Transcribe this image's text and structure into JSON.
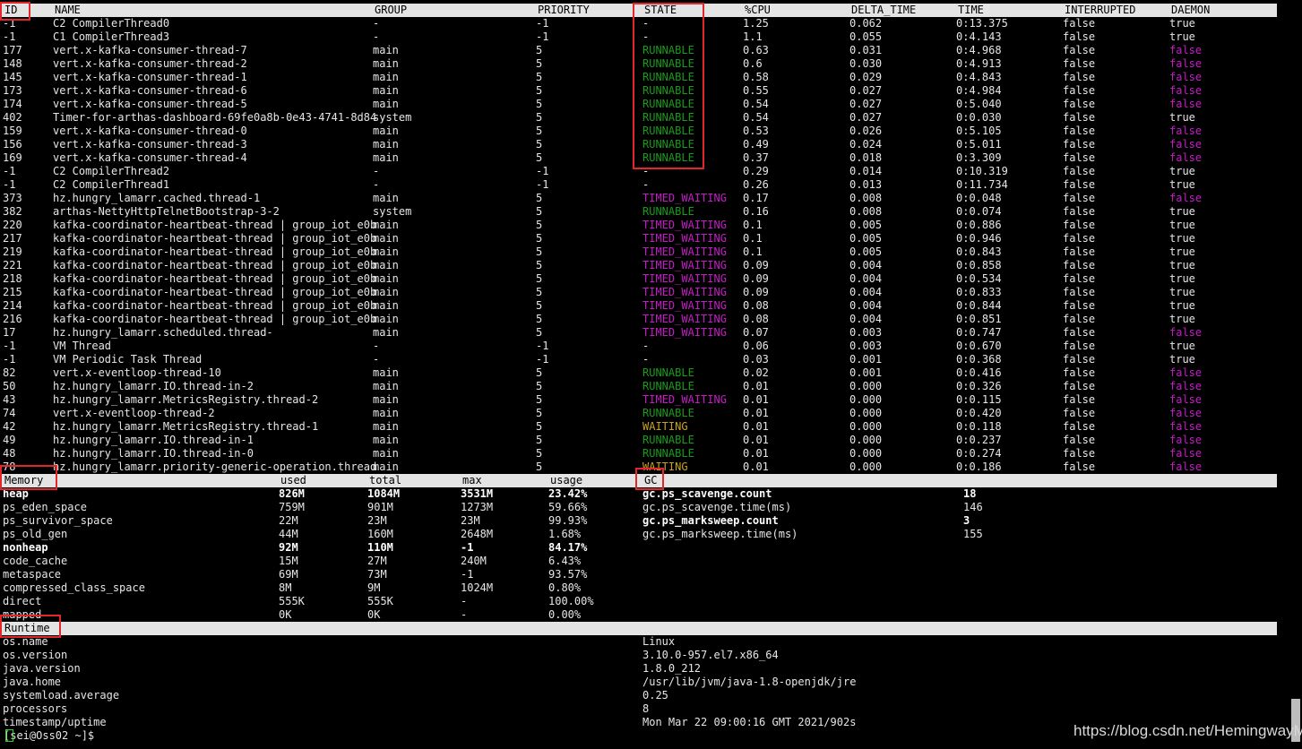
{
  "thread_table": {
    "headers": [
      "ID",
      "NAME",
      "GROUP",
      "PRIORITY",
      "STATE",
      "%CPU",
      "DELTA_TIME",
      "TIME",
      "INTERRUPTED",
      "DAEMON"
    ],
    "rows": [
      [
        "-1",
        "C2 CompilerThread0",
        "-",
        "-1",
        "-",
        "1.25",
        "0.062",
        "0:13.375",
        "false",
        "true"
      ],
      [
        "-1",
        "C1 CompilerThread3",
        "-",
        "-1",
        "-",
        "1.1",
        "0.055",
        "0:4.143",
        "false",
        "true"
      ],
      [
        "177",
        "vert.x-kafka-consumer-thread-7",
        "main",
        "5",
        "RUNNABLE",
        "0.63",
        "0.031",
        "0:4.968",
        "false",
        "false"
      ],
      [
        "148",
        "vert.x-kafka-consumer-thread-2",
        "main",
        "5",
        "RUNNABLE",
        "0.6",
        "0.030",
        "0:4.913",
        "false",
        "false"
      ],
      [
        "145",
        "vert.x-kafka-consumer-thread-1",
        "main",
        "5",
        "RUNNABLE",
        "0.58",
        "0.029",
        "0:4.843",
        "false",
        "false"
      ],
      [
        "173",
        "vert.x-kafka-consumer-thread-6",
        "main",
        "5",
        "RUNNABLE",
        "0.55",
        "0.027",
        "0:4.984",
        "false",
        "false"
      ],
      [
        "174",
        "vert.x-kafka-consumer-thread-5",
        "main",
        "5",
        "RUNNABLE",
        "0.54",
        "0.027",
        "0:5.040",
        "false",
        "false"
      ],
      [
        "402",
        "Timer-for-arthas-dashboard-69fe0a8b-0e43-4741-8d84",
        "system",
        "5",
        "RUNNABLE",
        "0.54",
        "0.027",
        "0:0.030",
        "false",
        "true"
      ],
      [
        "159",
        "vert.x-kafka-consumer-thread-0",
        "main",
        "5",
        "RUNNABLE",
        "0.53",
        "0.026",
        "0:5.105",
        "false",
        "false"
      ],
      [
        "156",
        "vert.x-kafka-consumer-thread-3",
        "main",
        "5",
        "RUNNABLE",
        "0.49",
        "0.024",
        "0:5.011",
        "false",
        "false"
      ],
      [
        "169",
        "vert.x-kafka-consumer-thread-4",
        "main",
        "5",
        "RUNNABLE",
        "0.37",
        "0.018",
        "0:3.309",
        "false",
        "false"
      ],
      [
        "-1",
        "C2 CompilerThread2",
        "-",
        "-1",
        "-",
        "0.29",
        "0.014",
        "0:10.319",
        "false",
        "true"
      ],
      [
        "-1",
        "C2 CompilerThread1",
        "-",
        "-1",
        "-",
        "0.26",
        "0.013",
        "0:11.734",
        "false",
        "true"
      ],
      [
        "373",
        "hz.hungry_lamarr.cached.thread-1",
        "main",
        "5",
        "TIMED_WAITING",
        "0.17",
        "0.008",
        "0:0.048",
        "false",
        "false"
      ],
      [
        "382",
        "arthas-NettyHttpTelnetBootstrap-3-2",
        "system",
        "5",
        "RUNNABLE",
        "0.16",
        "0.008",
        "0:0.074",
        "false",
        "true"
      ],
      [
        "220",
        "kafka-coordinator-heartbeat-thread | group_iot_e0b",
        "main",
        "5",
        "TIMED_WAITING",
        "0.1",
        "0.005",
        "0:0.886",
        "false",
        "true"
      ],
      [
        "217",
        "kafka-coordinator-heartbeat-thread | group_iot_e0b",
        "main",
        "5",
        "TIMED_WAITING",
        "0.1",
        "0.005",
        "0:0.946",
        "false",
        "true"
      ],
      [
        "219",
        "kafka-coordinator-heartbeat-thread | group_iot_e0b",
        "main",
        "5",
        "TIMED_WAITING",
        "0.1",
        "0.005",
        "0:0.843",
        "false",
        "true"
      ],
      [
        "221",
        "kafka-coordinator-heartbeat-thread | group_iot_e0b",
        "main",
        "5",
        "TIMED_WAITING",
        "0.09",
        "0.004",
        "0:0.858",
        "false",
        "true"
      ],
      [
        "218",
        "kafka-coordinator-heartbeat-thread | group_iot_e0b",
        "main",
        "5",
        "TIMED_WAITING",
        "0.09",
        "0.004",
        "0:0.534",
        "false",
        "true"
      ],
      [
        "215",
        "kafka-coordinator-heartbeat-thread | group_iot_e0b",
        "main",
        "5",
        "TIMED_WAITING",
        "0.09",
        "0.004",
        "0:0.833",
        "false",
        "true"
      ],
      [
        "214",
        "kafka-coordinator-heartbeat-thread | group_iot_e0b",
        "main",
        "5",
        "TIMED_WAITING",
        "0.08",
        "0.004",
        "0:0.844",
        "false",
        "true"
      ],
      [
        "216",
        "kafka-coordinator-heartbeat-thread | group_iot_e0b",
        "main",
        "5",
        "TIMED_WAITING",
        "0.08",
        "0.004",
        "0:0.851",
        "false",
        "true"
      ],
      [
        "17",
        "hz.hungry_lamarr.scheduled.thread-",
        "main",
        "5",
        "TIMED_WAITING",
        "0.07",
        "0.003",
        "0:0.747",
        "false",
        "false"
      ],
      [
        "-1",
        "VM Thread",
        "-",
        "-1",
        "-",
        "0.06",
        "0.003",
        "0:0.670",
        "false",
        "true"
      ],
      [
        "-1",
        "VM Periodic Task Thread",
        "-",
        "-1",
        "-",
        "0.03",
        "0.001",
        "0:0.368",
        "false",
        "true"
      ],
      [
        "82",
        "vert.x-eventloop-thread-10",
        "main",
        "5",
        "RUNNABLE",
        "0.02",
        "0.001",
        "0:0.416",
        "false",
        "false"
      ],
      [
        "50",
        "hz.hungry_lamarr.IO.thread-in-2",
        "main",
        "5",
        "RUNNABLE",
        "0.01",
        "0.000",
        "0:0.326",
        "false",
        "false"
      ],
      [
        "43",
        "hz.hungry_lamarr.MetricsRegistry.thread-2",
        "main",
        "5",
        "TIMED_WAITING",
        "0.01",
        "0.000",
        "0:0.115",
        "false",
        "false"
      ],
      [
        "74",
        "vert.x-eventloop-thread-2",
        "main",
        "5",
        "RUNNABLE",
        "0.01",
        "0.000",
        "0:0.420",
        "false",
        "false"
      ],
      [
        "42",
        "hz.hungry_lamarr.MetricsRegistry.thread-1",
        "main",
        "5",
        "WAITING",
        "0.01",
        "0.000",
        "0:0.118",
        "false",
        "false"
      ],
      [
        "49",
        "hz.hungry_lamarr.IO.thread-in-1",
        "main",
        "5",
        "RUNNABLE",
        "0.01",
        "0.000",
        "0:0.237",
        "false",
        "false"
      ],
      [
        "48",
        "hz.hungry_lamarr.IO.thread-in-0",
        "main",
        "5",
        "RUNNABLE",
        "0.01",
        "0.000",
        "0:0.274",
        "false",
        "false"
      ],
      [
        "78",
        "hz.hungry_lamarr.priority-generic-operation.thread",
        "main",
        "5",
        "WAITING",
        "0.01",
        "0.000",
        "0:0.186",
        "false",
        "false"
      ]
    ]
  },
  "memory": {
    "title": "Memory",
    "headers": [
      "used",
      "total",
      "max",
      "usage"
    ],
    "rows": [
      {
        "name": "heap",
        "used": "826M",
        "total": "1084M",
        "max": "3531M",
        "usage": "23.42%",
        "bold": true
      },
      {
        "name": "ps_eden_space",
        "used": "759M",
        "total": "901M",
        "max": "1273M",
        "usage": "59.66%",
        "bold": false
      },
      {
        "name": "ps_survivor_space",
        "used": "22M",
        "total": "23M",
        "max": "23M",
        "usage": "99.93%",
        "bold": false
      },
      {
        "name": "ps_old_gen",
        "used": "44M",
        "total": "160M",
        "max": "2648M",
        "usage": "1.68%",
        "bold": false
      },
      {
        "name": "nonheap",
        "used": "92M",
        "total": "110M",
        "max": "-1",
        "usage": "84.17%",
        "bold": true
      },
      {
        "name": "code_cache",
        "used": "15M",
        "total": "27M",
        "max": "240M",
        "usage": "6.43%",
        "bold": false
      },
      {
        "name": "metaspace",
        "used": "69M",
        "total": "73M",
        "max": "-1",
        "usage": "93.57%",
        "bold": false
      },
      {
        "name": "compressed_class_space",
        "used": "8M",
        "total": "9M",
        "max": "1024M",
        "usage": "0.80%",
        "bold": false
      },
      {
        "name": "direct",
        "used": "555K",
        "total": "555K",
        "max": "-",
        "usage": "100.00%",
        "bold": false
      },
      {
        "name": "mapped",
        "used": "0K",
        "total": "0K",
        "max": "-",
        "usage": "0.00%",
        "bold": false
      }
    ]
  },
  "gc": {
    "title": "GC",
    "rows": [
      {
        "name": "gc.ps_scavenge.count",
        "value": "18",
        "bold": true
      },
      {
        "name": "gc.ps_scavenge.time(ms)",
        "value": "146",
        "bold": false
      },
      {
        "name": "gc.ps_marksweep.count",
        "value": "3",
        "bold": true
      },
      {
        "name": "gc.ps_marksweep.time(ms)",
        "value": "155",
        "bold": false
      }
    ]
  },
  "runtime": {
    "title": "Runtime",
    "rows": [
      {
        "name": "os.name",
        "value": "Linux"
      },
      {
        "name": "os.version",
        "value": "3.10.0-957.el7.x86_64"
      },
      {
        "name": "java.version",
        "value": "1.8.0_212"
      },
      {
        "name": "java.home",
        "value": "/usr/lib/jvm/java-1.8-openjdk/jre"
      },
      {
        "name": "systemload.average",
        "value": "0.25"
      },
      {
        "name": "processors",
        "value": "8"
      },
      {
        "name": "timestamp/uptime",
        "value": "Mon Mar 22 09:00:16 GMT 2021/902s"
      }
    ]
  },
  "prompt": "[sei@Oss02 ~]$ ",
  "watermark": "https://blog.csdn.net/HemingwayM",
  "colors": {
    "runnable": "#1a9a1a",
    "timed_waiting": "#c71bc7",
    "waiting": "#c9a21f",
    "daemon_false": "#c71bc7",
    "annotation_box": "#e3262b",
    "header_bar": "#e4e4e4"
  }
}
